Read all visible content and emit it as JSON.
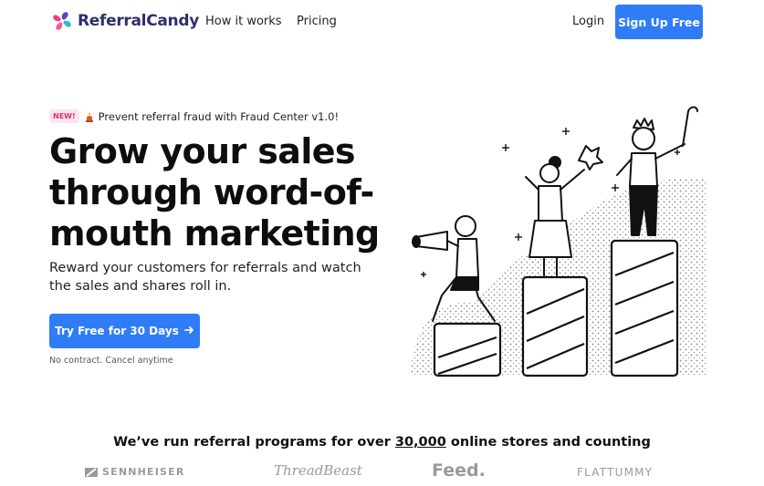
{
  "nav": {
    "brand": "ReferralCandy",
    "links": [
      "How it works",
      "Pricing"
    ],
    "login": "Login",
    "signup": "Sign Up Free"
  },
  "hero": {
    "badge": "NEW!",
    "announcement": "Prevent referral fraud with Fraud Center v1.0!",
    "title": "Grow your sales through word-of-mouth marketing",
    "subtitle": "Reward your customers for referrals and watch the sales and shares roll in.",
    "cta": "Try Free for 30 Days",
    "cta_icon": "arrow-right-icon",
    "fineprint": "No contract. Cancel anytime"
  },
  "trust": {
    "prefix": "We’ve run referral programs for over",
    "number": "30,000",
    "suffix": "online stores and counting"
  },
  "brands": [
    "SENNHEISER",
    "ThreadBeast",
    "Feed.",
    "FLATTUMMY"
  ],
  "colors": {
    "accent": "#2f7cf6",
    "brand_text": "#2d2f6b",
    "badge_bg": "#fde4ef",
    "badge_text": "#d6336c",
    "logo_pink": "#f0407c",
    "logo_teal": "#25c1c8",
    "logo_purple": "#5b3fd6"
  }
}
